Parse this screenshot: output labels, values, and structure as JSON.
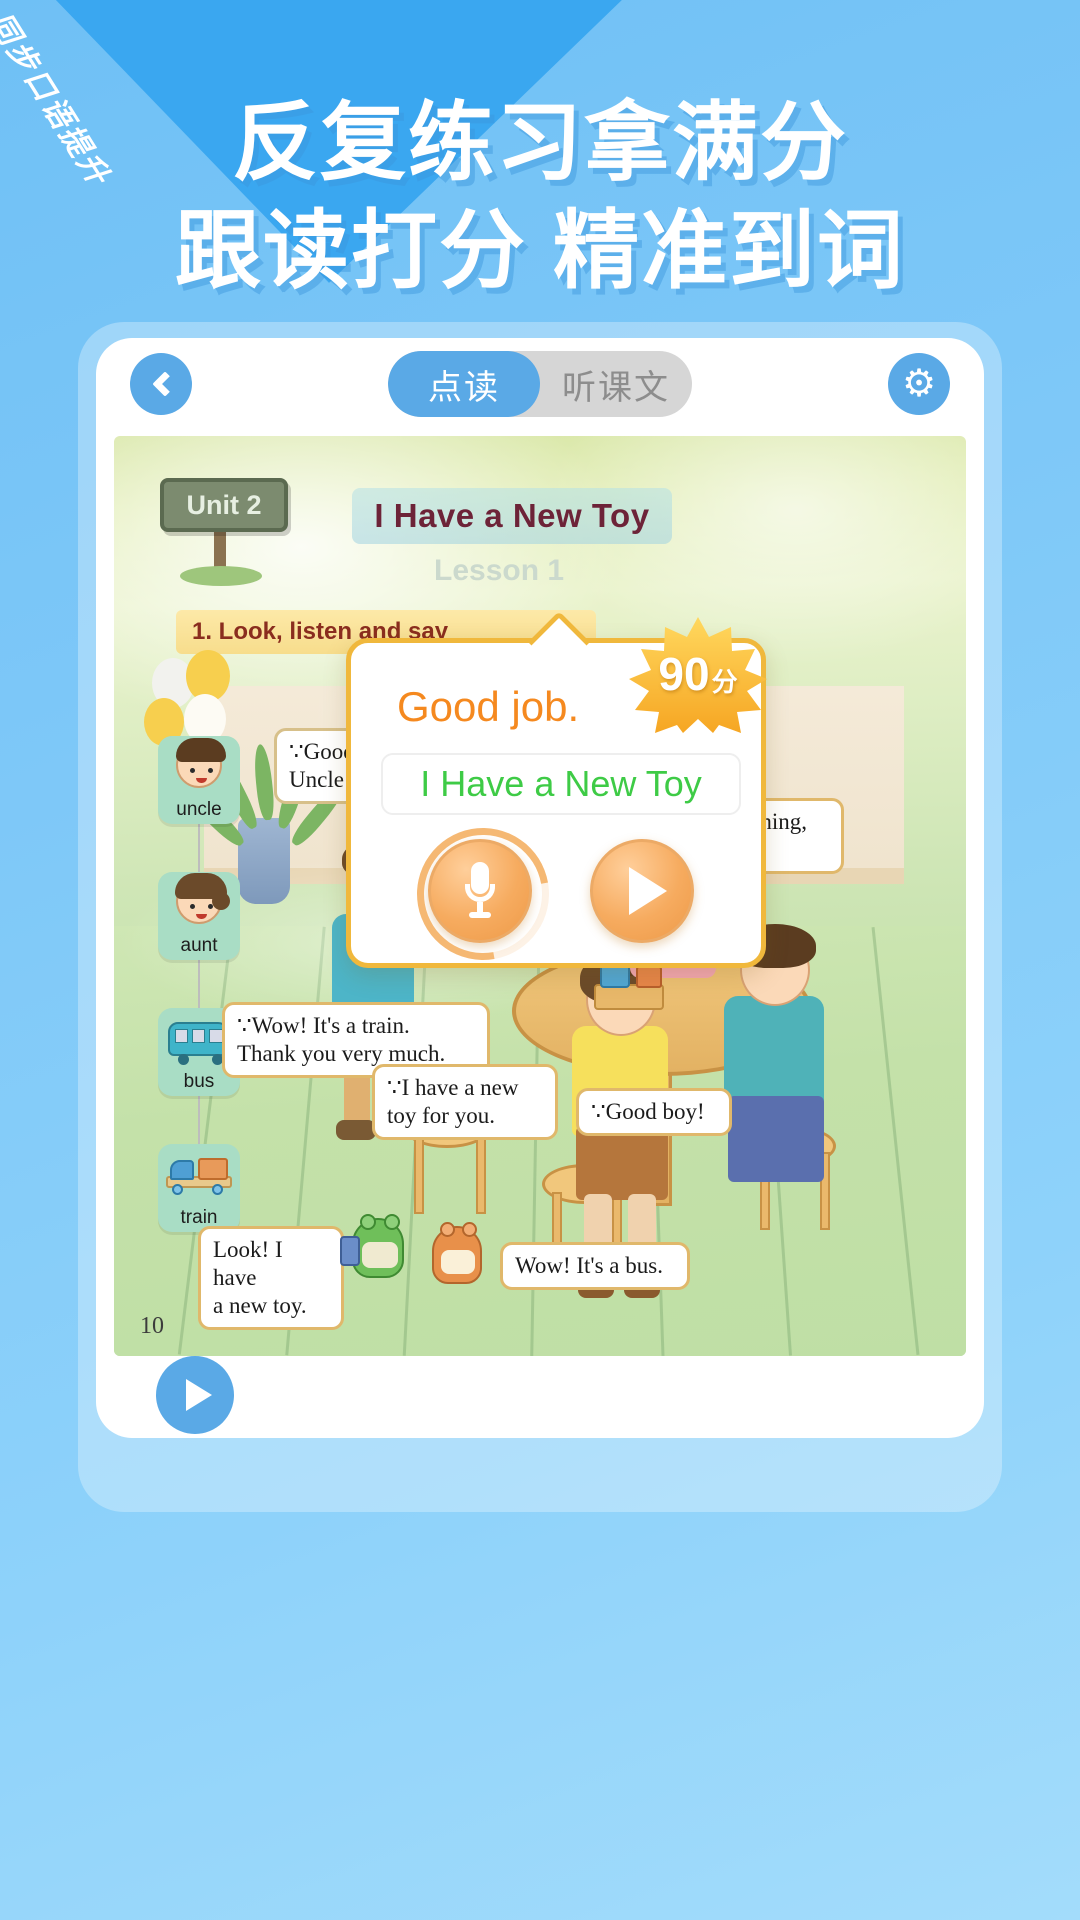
{
  "promo": {
    "ribbon": "同步口语提升",
    "line1": "反复练习拿满分",
    "line2": "跟读打分 精准到词",
    "accent": "#3aa7f0",
    "background": "#7ec8f8"
  },
  "toolbar": {
    "back_icon": "chevron-left-icon",
    "settings_icon": "gear-icon",
    "tabs": [
      {
        "label": "点读",
        "active": true
      },
      {
        "label": "听课文",
        "active": false
      }
    ],
    "active_color": "#5aa9e6",
    "inactive_color": "#d6d6d6"
  },
  "book": {
    "unit_label": "Unit 2",
    "lesson_title": "I Have a New Toy",
    "lesson_sub": "Lesson 1",
    "instruction": "1. Look, listen and say",
    "page_number": "10",
    "bubbles": [
      {
        "name": "bubble-good-evening",
        "text": "∵Good evening,\nUncle and Aunt!"
      },
      {
        "name": "bubble-good-evening-tian",
        "text": "∵Good evening,\nLi Tian!"
      },
      {
        "name": "bubble-wow-train",
        "text": "∵Wow! It's a train.\n  Thank you very much."
      },
      {
        "name": "bubble-new-toy",
        "text": "∵I have a new\n  toy for you."
      },
      {
        "name": "bubble-good-boy",
        "text": "∵Good boy!"
      },
      {
        "name": "bubble-look-new-toy",
        "text": "Look! I have\na new toy."
      },
      {
        "name": "bubble-wow-bus",
        "text": "Wow! It's a bus."
      }
    ],
    "word_cards": [
      {
        "label": "uncle",
        "icon": "uncle-face-icon"
      },
      {
        "label": "aunt",
        "icon": "aunt-face-icon"
      },
      {
        "label": "bus",
        "icon": "bus-icon"
      },
      {
        "label": "train",
        "icon": "train-icon"
      }
    ]
  },
  "dialog": {
    "praise": "Good job.",
    "praise_color": "#f5891f",
    "score_value": "90",
    "score_unit": "分",
    "sentence": "I Have a New Toy",
    "sentence_color": "#3ecb46",
    "record_icon": "microphone-icon",
    "play_icon": "play-icon",
    "border_color": "#f0b83c"
  },
  "bottom_bar": {
    "play_icon": "play-icon"
  }
}
